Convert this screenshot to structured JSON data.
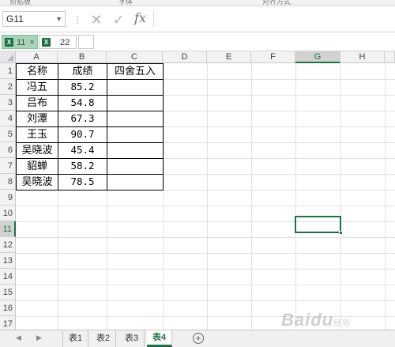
{
  "ribbon_fragments": [
    "剪贴板",
    "字体",
    "对齐方式"
  ],
  "formula_bar": {
    "name_box_value": "G11",
    "name_box_dropdown_icon": "chevron-down-icon",
    "separator_icon": "more-vertical-icon",
    "cancel_icon": "close-icon",
    "confirm_icon": "check-icon",
    "fx_label": "fx",
    "formula_value": ""
  },
  "thumb_tabs": [
    {
      "label": "11",
      "badge": "X",
      "active": true
    },
    {
      "label": "22",
      "badge": "X",
      "active": false
    }
  ],
  "columns": [
    "A",
    "B",
    "C",
    "D",
    "E",
    "F",
    "G",
    "H"
  ],
  "selected_column": "G",
  "rows": [
    "1",
    "2",
    "3",
    "4",
    "5",
    "6",
    "7",
    "8",
    "9",
    "10",
    "11",
    "12",
    "13",
    "14",
    "15",
    "16",
    "17"
  ],
  "selected_row": "11",
  "active_cell": "G11",
  "table": {
    "headers": [
      "名称",
      "成绩",
      "四舍五入"
    ],
    "records": [
      {
        "name": "冯五",
        "score": "85.2",
        "rounded": ""
      },
      {
        "name": "吕布",
        "score": "54.8",
        "rounded": ""
      },
      {
        "name": "刘潭",
        "score": "67.3",
        "rounded": ""
      },
      {
        "name": "王玉",
        "score": "90.7",
        "rounded": ""
      },
      {
        "name": "吴晓波",
        "score": "45.4",
        "rounded": ""
      },
      {
        "name": "貂蝉",
        "score": "58.2",
        "rounded": ""
      },
      {
        "name": "吴晓波",
        "score": "78.5",
        "rounded": ""
      }
    ]
  },
  "sheet_tabs": [
    {
      "label": "表1",
      "active": false
    },
    {
      "label": "表2",
      "active": false
    },
    {
      "label": "表3",
      "active": false
    },
    {
      "label": "表4",
      "active": true
    }
  ],
  "add_sheet_label": "+",
  "watermark": {
    "text": "Baidu",
    "sub": "经验"
  },
  "colors": {
    "accent": "#1e7145",
    "active_thumb": "#a8d3b8"
  }
}
